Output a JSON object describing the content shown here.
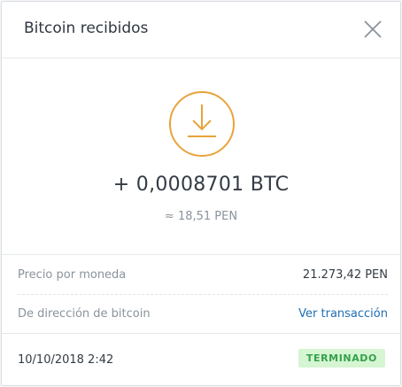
{
  "header": {
    "title": "Bitcoin recibidos",
    "close_icon": "close-icon"
  },
  "hero": {
    "icon": "download-icon",
    "icon_color": "#e8a33b",
    "amount": "+ 0,0008701 BTC",
    "fiat": "≈ 18,51 PEN"
  },
  "details": {
    "price_label": "Precio por moneda",
    "price_value": "21.273,42 PEN",
    "address_label": "De dirección de bitcoin",
    "address_link": "Ver transacción"
  },
  "footer": {
    "date": "10/10/2018 2:42",
    "status": "TERMINADO",
    "status_color": "#33a24a",
    "status_bg": "#d6f5d3"
  },
  "colors": {
    "accent_link": "#1f6fb4",
    "text": "#333b44",
    "muted": "#8a939c"
  }
}
